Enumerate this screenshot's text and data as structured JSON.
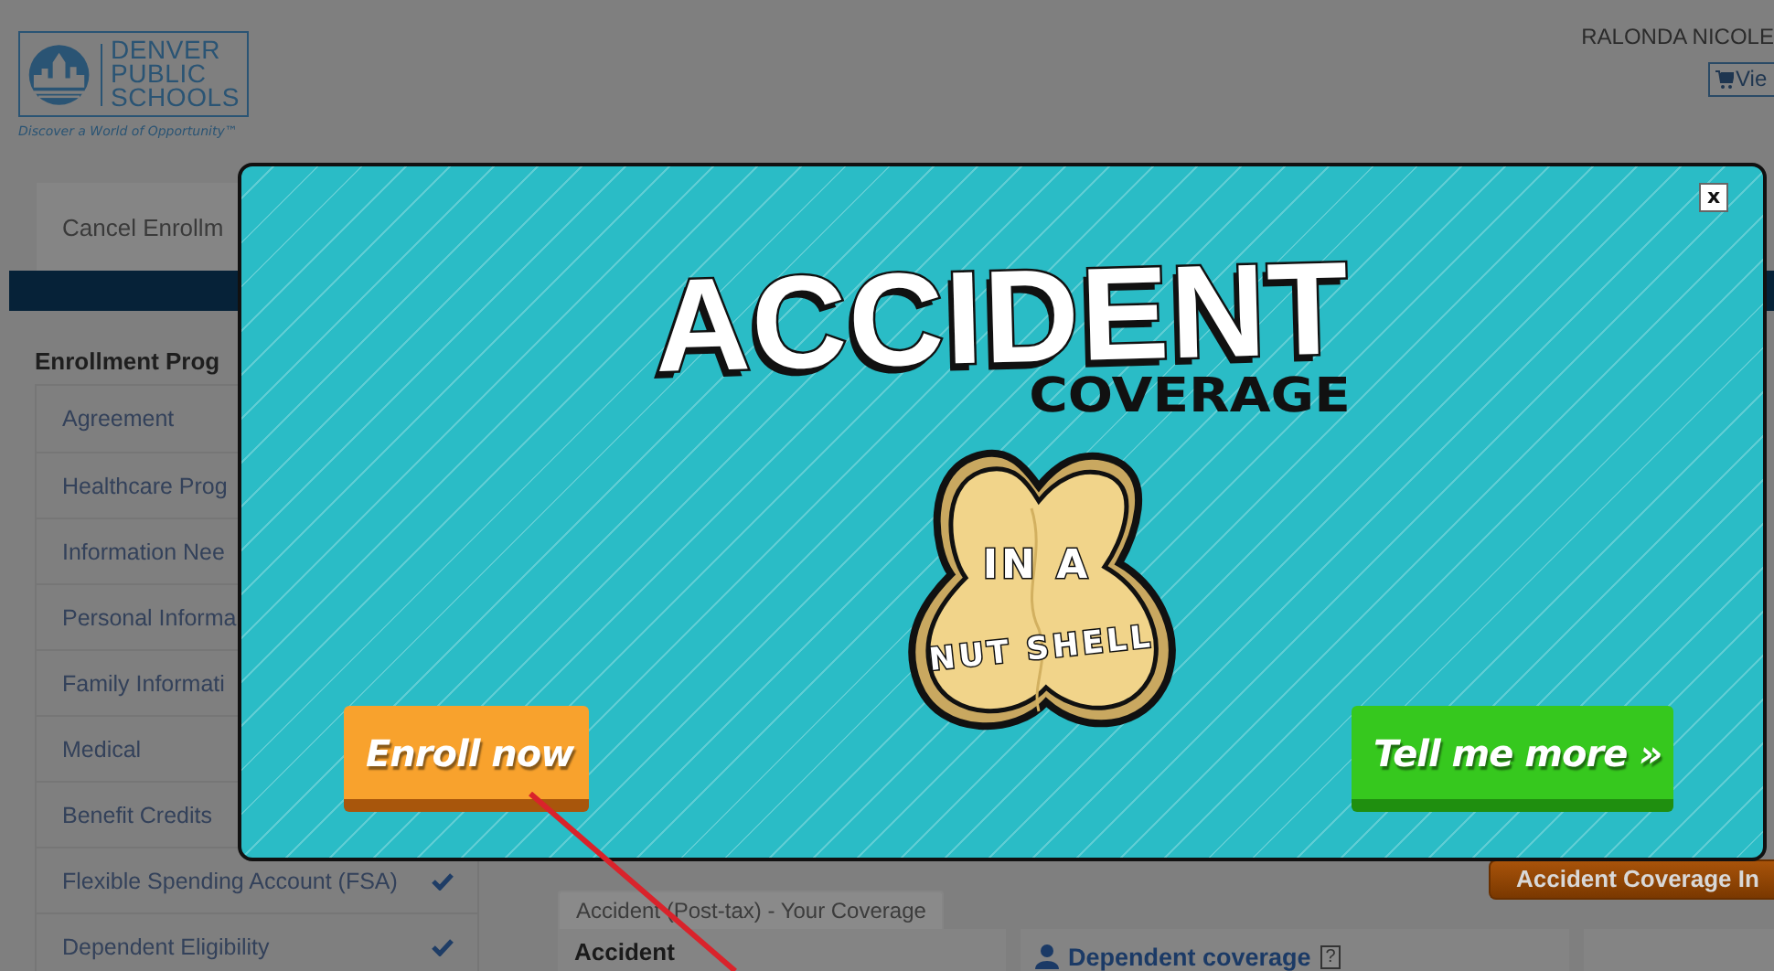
{
  "header": {
    "logo_text": "DENVER PUBLIC SCHOOLS",
    "tagline": "Discover a World of Opportunity™",
    "user_name": "RALONDA NICOLE",
    "view_button": "Vie"
  },
  "cancel_button": "Cancel Enrollm",
  "sidebar": {
    "title": "Enrollment Prog",
    "items": [
      {
        "label": "Agreement"
      },
      {
        "label": "Healthcare Prog"
      },
      {
        "label": "Information Nee"
      },
      {
        "label": "Personal Informa"
      },
      {
        "label": "Family Informati"
      },
      {
        "label": "Medical"
      },
      {
        "label": "Benefit Credits"
      },
      {
        "label": "Flexible Spending Account (FSA)",
        "checked": true
      },
      {
        "label": "Dependent Eligibility",
        "checked": true
      }
    ]
  },
  "content": {
    "info_button": "Accident Coverage In",
    "coverage_tab": "Accident (Post-tax) - Your Coverage",
    "plan_name": "Accident",
    "dependent_coverage": "Dependent coverage",
    "help": "?"
  },
  "modal": {
    "close": "x",
    "title": "ACCIDENT",
    "subtitle": "COVERAGE",
    "badge_lines": [
      "IN A",
      "NUT SHELL"
    ],
    "buttons": [
      {
        "label": "Enroll now",
        "kind": "primary"
      },
      {
        "label": "Tell me more »",
        "kind": "secondary"
      }
    ]
  }
}
